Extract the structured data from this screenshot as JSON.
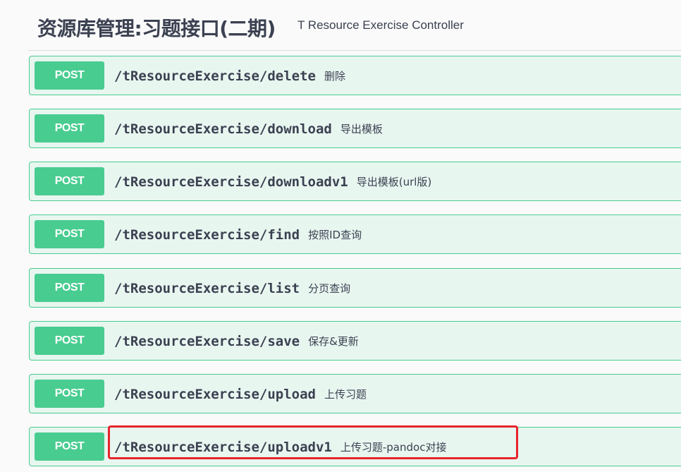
{
  "tag": {
    "title": "资源库管理:习题接口(二期)",
    "description": "T Resource Exercise Controller"
  },
  "operations": [
    {
      "method": "POST",
      "path": "/tResourceExercise/delete",
      "summary": "删除"
    },
    {
      "method": "POST",
      "path": "/tResourceExercise/download",
      "summary": "导出模板"
    },
    {
      "method": "POST",
      "path": "/tResourceExercise/downloadv1",
      "summary": "导出模板(url版)"
    },
    {
      "method": "POST",
      "path": "/tResourceExercise/find",
      "summary": "按照ID查询"
    },
    {
      "method": "POST",
      "path": "/tResourceExercise/list",
      "summary": "分页查询"
    },
    {
      "method": "POST",
      "path": "/tResourceExercise/save",
      "summary": "保存&更新"
    },
    {
      "method": "POST",
      "path": "/tResourceExercise/upload",
      "summary": "上传习题"
    },
    {
      "method": "POST",
      "path": "/tResourceExercise/uploadv1",
      "summary": "上传习题-pandoc对接"
    }
  ],
  "colors": {
    "post": "#49cc90",
    "post_bg": "#e8f6f0",
    "highlight": "#e8242b",
    "text": "#3b4151"
  }
}
